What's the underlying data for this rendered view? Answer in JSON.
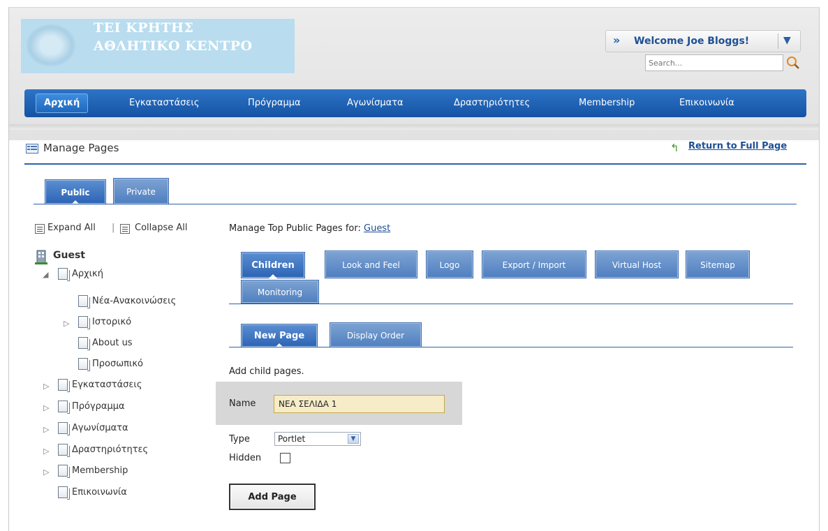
{
  "brand": {
    "line1": "ΤΕΙ ΚΡΗΤΗΣ",
    "line2": "ΑΘΛΗΤΙΚΟ ΚΕΝΤΡΟ",
    "seal_icon": "university-seal-icon"
  },
  "user": {
    "welcome": "Welcome Joe Bloggs!"
  },
  "search": {
    "placeholder": "Search..."
  },
  "nav": {
    "items": [
      {
        "label": "Αρχική",
        "active": true
      },
      {
        "label": "Εγκαταστάσεις"
      },
      {
        "label": "Πρόγραμμα"
      },
      {
        "label": "Αγωνίσματα"
      },
      {
        "label": "Δραστηριότητες"
      },
      {
        "label": "Membership"
      },
      {
        "label": "Επικοινωνία"
      }
    ]
  },
  "portlet": {
    "title": "Manage Pages",
    "return_link": "Return to Full Page"
  },
  "top_tabs": [
    "Public",
    "Private"
  ],
  "tree_tools": {
    "expand": "Expand All",
    "separator": "|",
    "collapse": "Collapse All"
  },
  "tree": {
    "root": "Guest",
    "items": [
      "Αρχική",
      "Νέα-Ανακοινώσεις",
      "Ιστορικό",
      "About us",
      "Προσωπικό",
      "Εγκαταστάσεις",
      "Πρόγραμμα",
      "Αγωνίσματα",
      "Δραστηριότητες",
      "Membership",
      "Επικοινωνία"
    ]
  },
  "manage": {
    "prefix": "Manage Top Public Pages for:",
    "link": "Guest"
  },
  "section_tabs": [
    "Children",
    "Look and Feel",
    "Logo",
    "Export / Import",
    "Virtual Host",
    "Sitemap",
    "Monitoring"
  ],
  "sub_tabs": [
    "New Page",
    "Display Order"
  ],
  "form": {
    "intro": "Add child pages.",
    "name_label": "Name",
    "name_value": "ΝΕΑ ΣΕΛΙΔΑ 1",
    "type_label": "Type",
    "type_value": "Portlet",
    "hidden_label": "Hidden",
    "hidden_checked": false,
    "submit": "Add Page"
  },
  "colors": {
    "nav": "#1553a4",
    "accent": "#1d4f95",
    "logo_bg": "#b9dcef",
    "name_field": "#f6ecc7"
  }
}
